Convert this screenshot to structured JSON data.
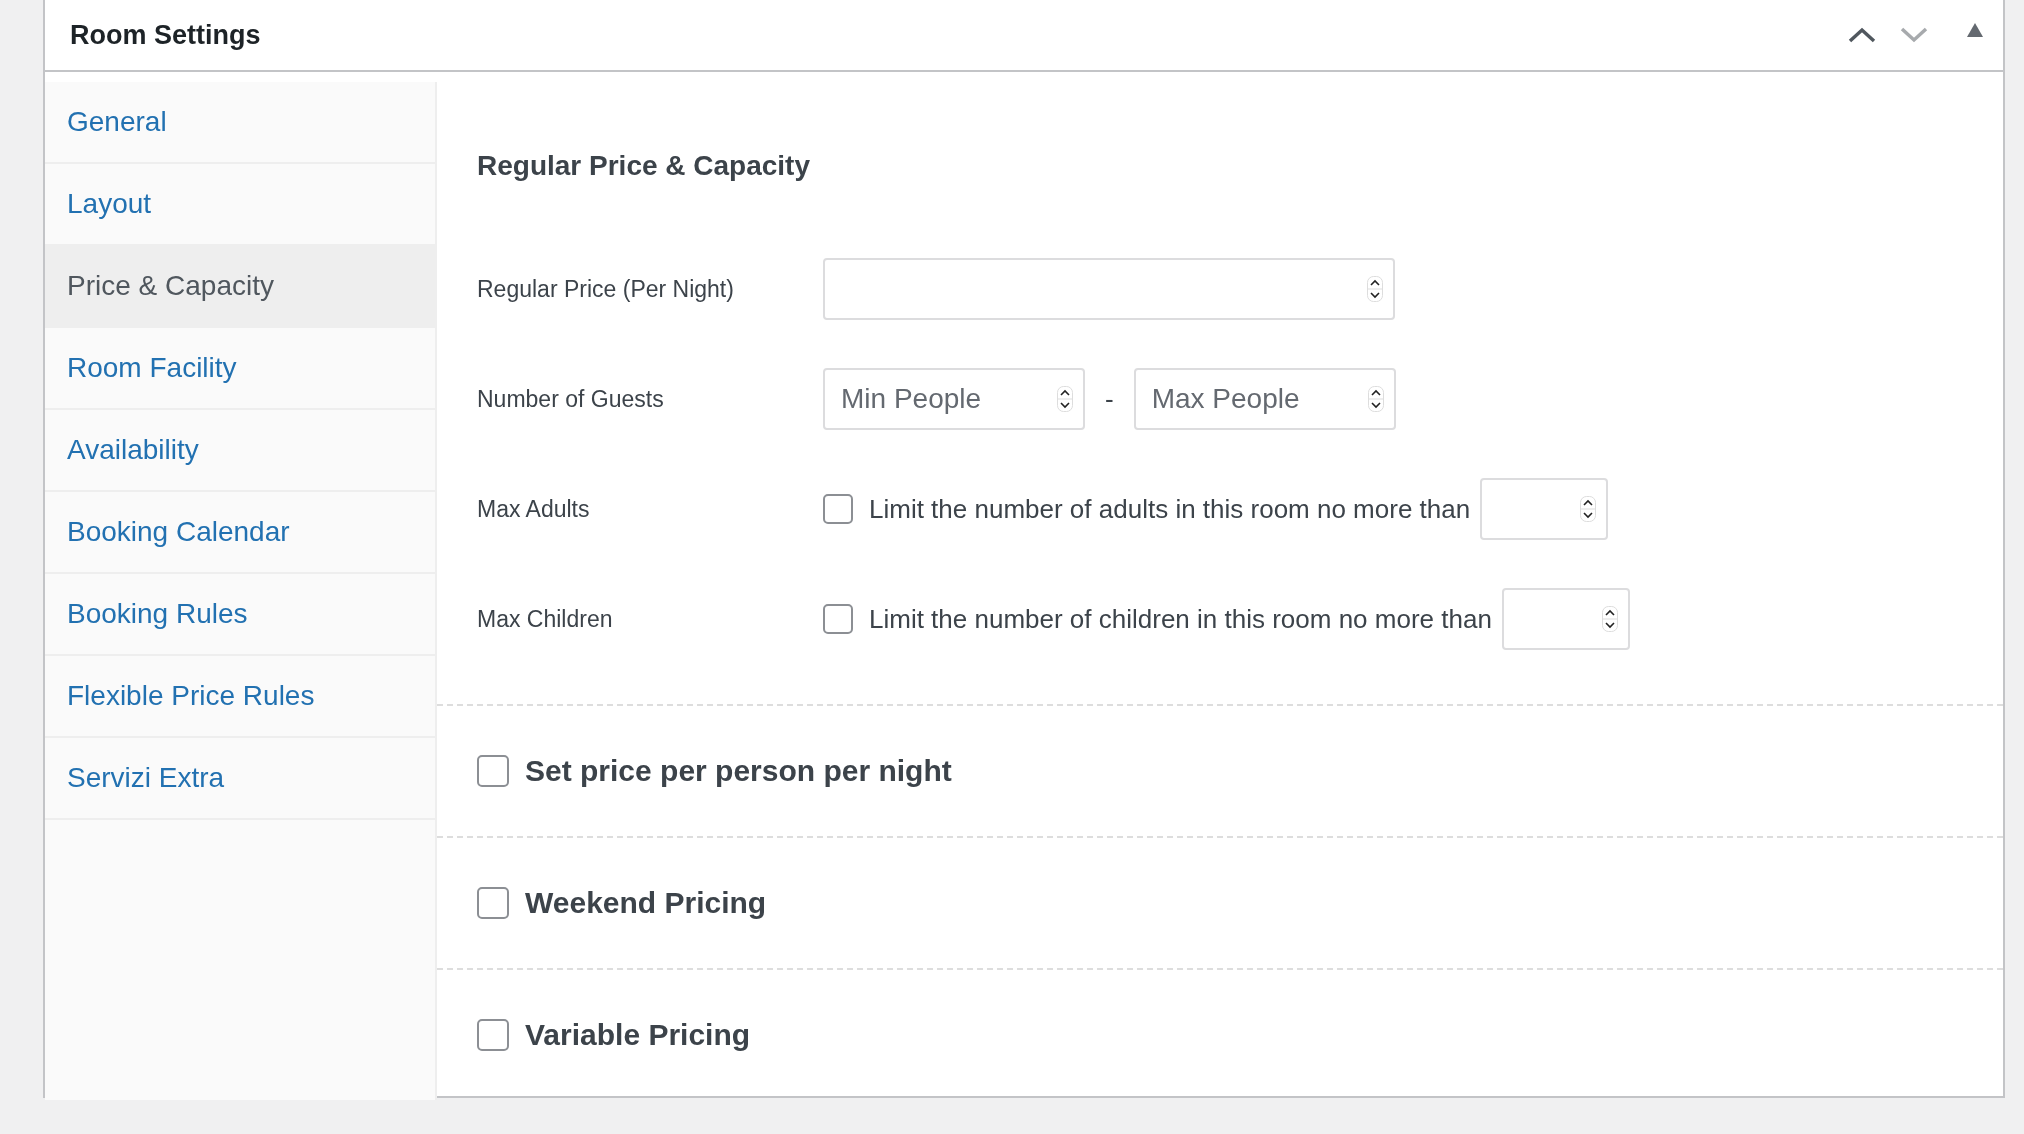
{
  "window": {
    "title": "Room Settings"
  },
  "sidebar": {
    "items": [
      {
        "label": "General",
        "selected": false
      },
      {
        "label": "Layout",
        "selected": false
      },
      {
        "label": "Price & Capacity",
        "selected": true
      },
      {
        "label": "Room Facility",
        "selected": false
      },
      {
        "label": "Availability",
        "selected": false
      },
      {
        "label": "Booking Calendar",
        "selected": false
      },
      {
        "label": "Booking Rules",
        "selected": false
      },
      {
        "label": "Flexible Price Rules",
        "selected": false
      },
      {
        "label": "Servizi Extra",
        "selected": false
      }
    ]
  },
  "section": {
    "heading": "Regular Price & Capacity",
    "rows": [
      {
        "kind": "single",
        "label": "Regular Price (Per Night)"
      },
      {
        "kind": "range",
        "label": "Number of Guests",
        "fields": [
          {
            "placeholder": "Min People"
          },
          {
            "placeholder": "Max People"
          }
        ],
        "separator": "-"
      },
      {
        "kind": "limit",
        "label": "Max Adults",
        "checked": false,
        "text": "Limit the number of adults in this room no more than"
      },
      {
        "kind": "limit",
        "label": "Max Children",
        "checked": false,
        "text": "Limit the number of children in this room no more than"
      }
    ]
  },
  "options": [
    {
      "label": "Set price per person per night",
      "checked": false
    },
    {
      "label": "Weekend Pricing",
      "checked": false
    },
    {
      "label": "Variable Pricing",
      "checked": false
    }
  ]
}
